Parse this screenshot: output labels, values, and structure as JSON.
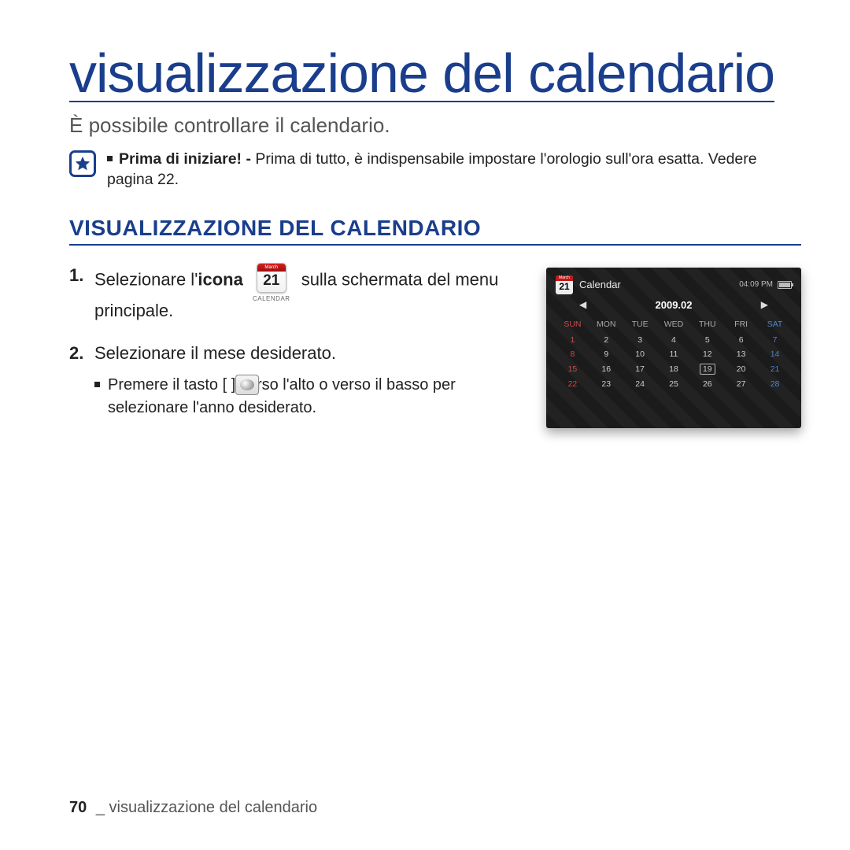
{
  "page": {
    "title": "visualizzazione del calendario",
    "intro": "È possibile controllare il calendario.",
    "note_bold": "Prima di iniziare! - ",
    "note_text": "Prima di tutto, è indispensabile impostare l'orologio sull'ora esatta. Vedere pagina 22."
  },
  "section_heading": "VISUALIZZAZIONE DEL CALENDARIO",
  "steps": {
    "s1_a": "Selezionare l'",
    "s1_bold": "icona",
    "s1_b": "sulla schermata del menu principale.",
    "s2": "Selezionare il mese desiderato.",
    "s2_sub": "Premere il tasto [           ] verso l'alto o verso il basso per selezionare l'anno desiderato."
  },
  "inline_icon": {
    "tab": "March",
    "num": "21",
    "caption": "CALENDAR"
  },
  "device": {
    "icon_tab": "March",
    "icon_num": "21",
    "title": "Calendar",
    "time": "04:09 PM",
    "month_label": "2009.02",
    "days": {
      "sun": "SUN",
      "mon": "MON",
      "tue": "TUE",
      "wed": "WED",
      "thu": "THU",
      "fri": "FRI",
      "sat": "SAT"
    },
    "rows": [
      [
        "1",
        "2",
        "3",
        "4",
        "5",
        "6",
        "7"
      ],
      [
        "8",
        "9",
        "10",
        "11",
        "12",
        "13",
        "14"
      ],
      [
        "15",
        "16",
        "17",
        "18",
        "19",
        "20",
        "21"
      ],
      [
        "22",
        "23",
        "24",
        "25",
        "26",
        "27",
        "28"
      ]
    ],
    "selected": "19"
  },
  "footer": {
    "page": "70",
    "sep": "_",
    "text": "visualizzazione del calendario"
  }
}
